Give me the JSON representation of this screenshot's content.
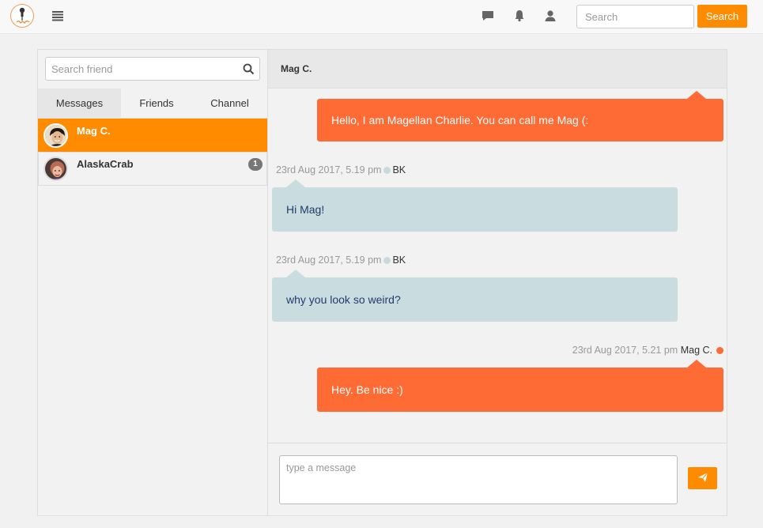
{
  "navbar": {
    "search_placeholder": "Search",
    "search_button": "Search",
    "icons": [
      "menu-icon",
      "chat-icon",
      "bell-icon",
      "user-icon"
    ],
    "accent": "#ff8c00"
  },
  "sidebar": {
    "search_placeholder": "Search friend",
    "tabs": [
      {
        "label": "Messages",
        "active": true
      },
      {
        "label": "Friends",
        "active": false
      },
      {
        "label": "Channel",
        "active": false
      }
    ],
    "contacts": [
      {
        "name": "Mag C.",
        "active": true,
        "badge": ""
      },
      {
        "name": "AlaskaCrab",
        "active": false,
        "badge": "1"
      }
    ]
  },
  "conversation": {
    "title": "Mag C.",
    "messages": [
      {
        "direction": "out",
        "text": "Hello, I am Magellan Charlie. You can call me Mag (:",
        "time": "",
        "author": ""
      },
      {
        "direction": "in",
        "text": "Hi Mag!",
        "time": "23rd Aug 2017, 5.19 pm",
        "author": "BK"
      },
      {
        "direction": "in",
        "text": "why you look so weird?",
        "time": "23rd Aug 2017, 5.19 pm",
        "author": "BK"
      },
      {
        "direction": "out",
        "text": "Hey. Be nice :)",
        "time": "23rd Aug 2017, 5.21 pm",
        "author": "Mag C."
      }
    ],
    "composer_placeholder": "type a message",
    "colors": {
      "outgoing": "#ff6b35",
      "incoming": "#c9dce0"
    }
  }
}
